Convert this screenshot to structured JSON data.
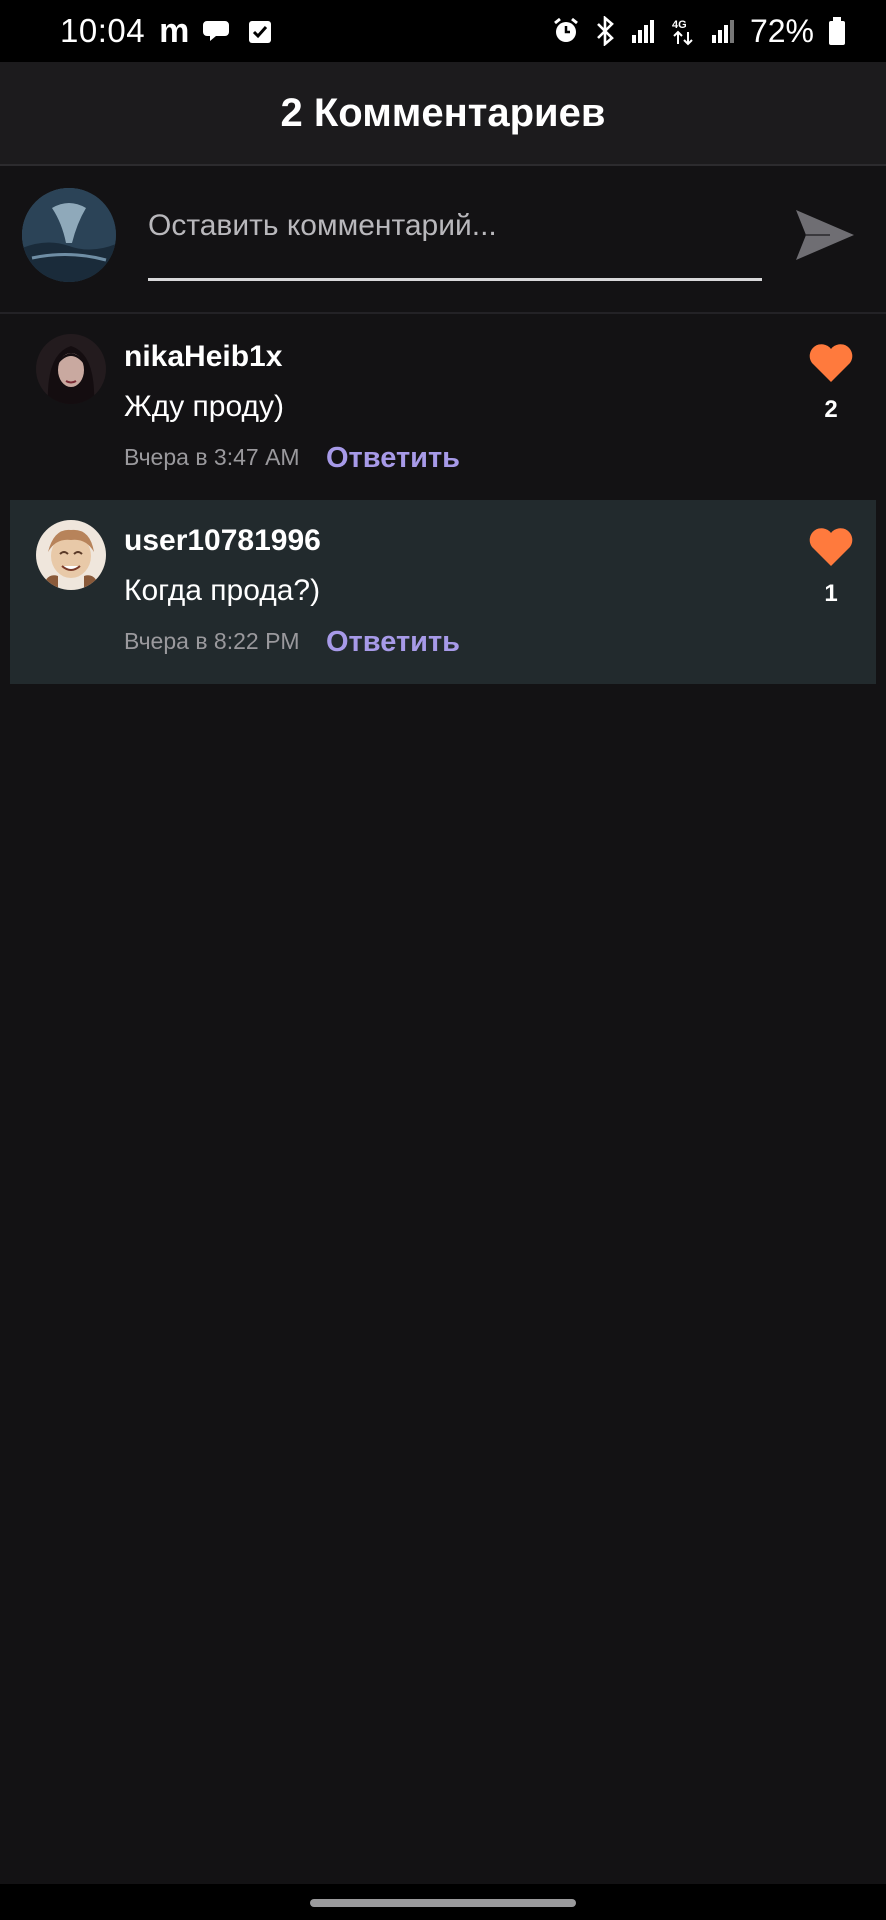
{
  "status_bar": {
    "time": "10:04",
    "app_letter": "m",
    "battery": "72%",
    "icons": [
      "messages-icon",
      "check-icon",
      "alarm-icon",
      "bluetooth-icon",
      "signal-icon",
      "4g-icon",
      "signal-icon",
      "battery-icon"
    ]
  },
  "header": {
    "title": "2 Комментариев"
  },
  "composer": {
    "placeholder": "Оставить комментарий...",
    "value": ""
  },
  "comments": [
    {
      "username": "nikaHeib1x",
      "text": "Жду проду)",
      "time": "Вчера в 3:47 AM",
      "reply_label": "Ответить",
      "likes": "2",
      "highlighted": false
    },
    {
      "username": "user10781996",
      "text": "Когда прода?)",
      "time": "Вчера в 8:22 PM",
      "reply_label": "Ответить",
      "likes": "1",
      "highlighted": true
    }
  ],
  "colors": {
    "background": "#131214",
    "header_bg": "#1c1b1d",
    "highlight_bg": "#222a2d",
    "accent_reply": "#a79ae8",
    "heart": "#ff7a3d",
    "muted_text": "#9a999d"
  }
}
